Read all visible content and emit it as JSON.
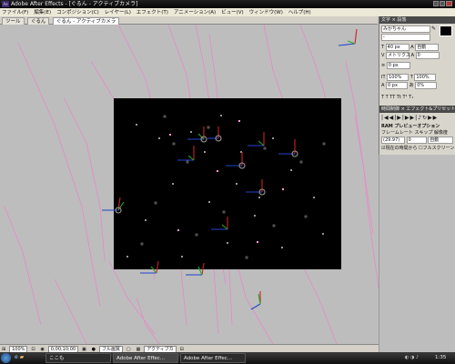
{
  "window": {
    "title": "Adobe After Effects - [ぐるん - アクティブカメラ]"
  },
  "menu": [
    "ファイル(F)",
    "編集(E)",
    "コンポジション(C)",
    "レイヤー(L)",
    "エフェクト(T)",
    "アニメーション(A)",
    "ビュー(V)",
    "ウィンドウ(W)",
    "ヘルプ(H)"
  ],
  "tabs": [
    "ツール",
    "ぐるん",
    "ぐるん - アクティブカメラ"
  ],
  "character_panel": {
    "tabs": "文字 × 段落",
    "font": "みかちゃん",
    "style": "-",
    "size": "40 px",
    "leading": "自動",
    "kerning": "メトリクス",
    "tracking": "0",
    "stroke": "0 px",
    "vscale": "100%",
    "hscale": "100%",
    "baseline": "0 px",
    "tsume": "0%",
    "styles": "T  T  TT  Tt  T¹  T₁"
  },
  "preview_panel": {
    "tabs": "時間制御 × エフェクト&プリセット",
    "ram_title": "RAM プレビューオプション",
    "labels": "フレームレート スキップ 解像度",
    "framerate": "(29.97)",
    "skip": "0",
    "resolution": "自動",
    "from_current": "現在の時間から",
    "fullscreen": "フルスクリーン"
  },
  "viewer_toolbar": {
    "zoom": "100%",
    "timecode": "0;00;10;00",
    "quality": "フル画質",
    "camera": "アクティブカ"
  },
  "taskbar": {
    "items": [
      "ここも",
      "Adobe After Effec...",
      "Adobe After Effec..."
    ],
    "clock": "1:35"
  }
}
